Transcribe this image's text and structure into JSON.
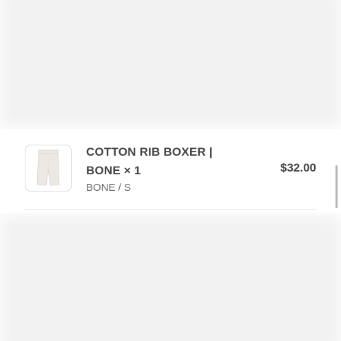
{
  "line_item": {
    "image": {
      "icon": "boxer-shorts-thumbnail",
      "color": "#ece9e2"
    },
    "title_line1": "COTTON RIB BOXER |",
    "title_line2": "BONE × 1",
    "variant": "BONE / S",
    "price": "$32.00"
  },
  "colors": {
    "text_primary": "#444444",
    "text_secondary": "#666666",
    "border": "#d9d9d9"
  }
}
